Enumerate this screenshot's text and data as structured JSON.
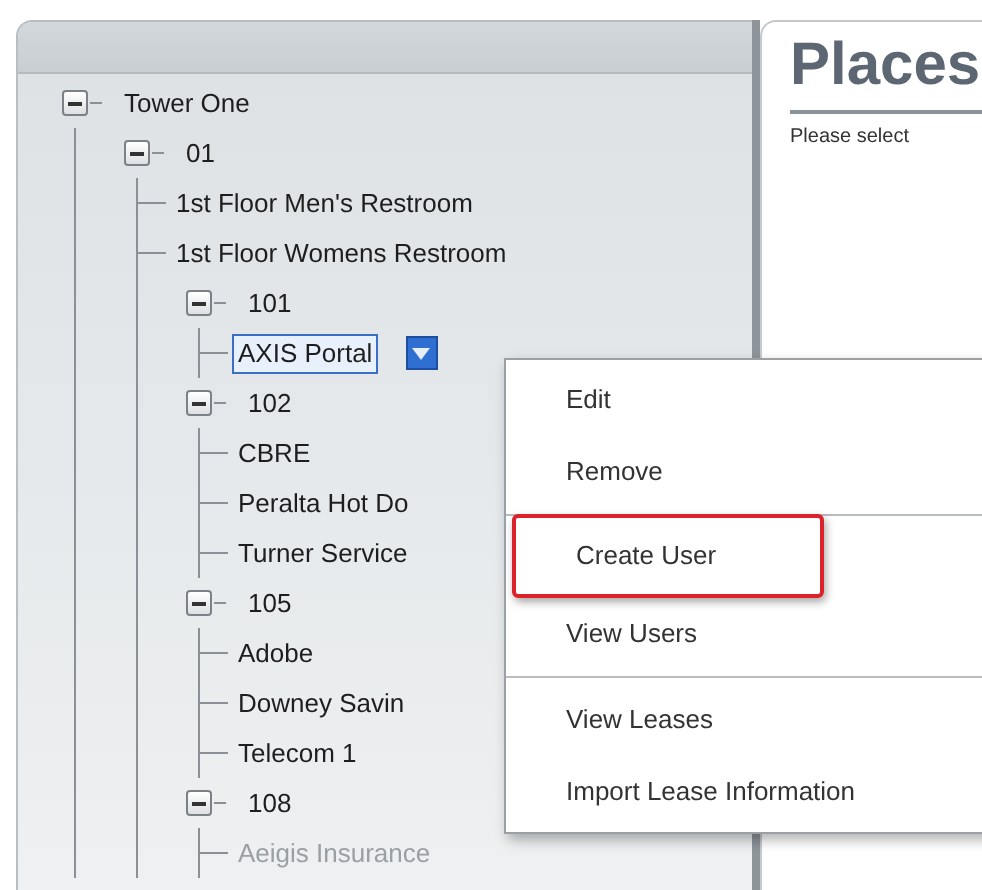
{
  "tree": [
    {
      "label": "Tower One",
      "expanded": true,
      "selected": false,
      "disabled": false,
      "children": [
        {
          "label": "01",
          "expanded": true,
          "selected": false,
          "disabled": false,
          "children": [
            {
              "label": "1st Floor Men's Restroom",
              "selected": false,
              "disabled": false
            },
            {
              "label": "1st Floor Womens Restroom",
              "selected": false,
              "disabled": false
            },
            {
              "label": "101",
              "expanded": true,
              "selected": false,
              "disabled": false,
              "children": [
                {
                  "label": "AXIS Portal",
                  "selected": true,
                  "disabled": false
                }
              ]
            },
            {
              "label": "102",
              "expanded": true,
              "selected": false,
              "disabled": false,
              "children": [
                {
                  "label": "CBRE",
                  "selected": false,
                  "disabled": false
                },
                {
                  "label": "Peralta Hot Do",
                  "selected": false,
                  "disabled": false
                },
                {
                  "label": "Turner Service",
                  "selected": false,
                  "disabled": false
                }
              ]
            },
            {
              "label": "105",
              "expanded": true,
              "selected": false,
              "disabled": false,
              "children": [
                {
                  "label": "Adobe",
                  "selected": false,
                  "disabled": false
                },
                {
                  "label": "Downey Savin",
                  "selected": false,
                  "disabled": false
                },
                {
                  "label": "Telecom 1",
                  "selected": false,
                  "disabled": false
                }
              ]
            },
            {
              "label": "108",
              "expanded": true,
              "selected": false,
              "disabled": false,
              "children": [
                {
                  "label": "Aeigis Insurance",
                  "selected": false,
                  "disabled": true
                }
              ]
            }
          ]
        }
      ]
    }
  ],
  "content": {
    "title": "Places",
    "text": "Please select"
  },
  "context_menu": {
    "groups": [
      [
        {
          "label": "Edit",
          "highlighted": false
        },
        {
          "label": "Remove",
          "highlighted": false
        }
      ],
      [
        {
          "label": "Create User",
          "highlighted": true
        },
        {
          "label": "View Users",
          "highlighted": false
        }
      ],
      [
        {
          "label": "View Leases",
          "highlighted": false
        },
        {
          "label": "Import Lease Information",
          "highlighted": false
        }
      ]
    ]
  }
}
